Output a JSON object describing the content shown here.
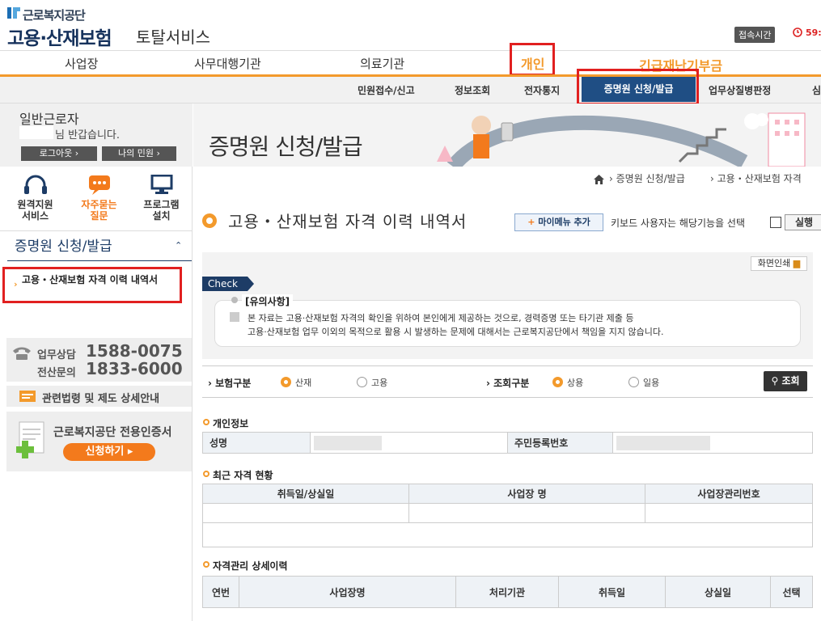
{
  "header": {
    "org_name": "근로복지공단",
    "service_name": "고용·산재보험",
    "service_suffix": "토탈서비스",
    "session_label": "접속시간",
    "session_timer": "59:"
  },
  "gnb": {
    "items": [
      "사업장",
      "사무대행기관",
      "의료기관",
      "개인",
      "긴급재난기부금"
    ]
  },
  "snb": {
    "items": [
      "민원접수/신고",
      "정보조회",
      "전자통지",
      "증명원 신청/발급",
      "업무상질병판정",
      "심"
    ]
  },
  "user": {
    "type": "일반근로자",
    "greeting": "님 반갑습니다.",
    "logout": "로그아웃",
    "my_civil": "나의 민원"
  },
  "quick": [
    {
      "label": "원격지원\n서비스",
      "icon": "headset-icon"
    },
    {
      "label": "자주묻는\n질문",
      "icon": "chat-icon"
    },
    {
      "label": "프로그램\n설치",
      "icon": "monitor-icon"
    }
  ],
  "lnb": {
    "title": "증명원 신청/발급",
    "item": "고용・산재보험 자격 이력 내역서"
  },
  "contact": {
    "work_label": "업무상담",
    "work_number": "1588-0075",
    "it_label": "전산문의",
    "it_number": "1833-6000",
    "law_link": "관련법령 및 제도 상세안내",
    "cert_title": "근로복지공단 전용인증서",
    "cert_btn": "신청하기"
  },
  "banner": {
    "title": "증명원 신청/발급"
  },
  "breadcrumb": {
    "items": [
      "증명원 신청/발급",
      "고용・산재보험 자격"
    ]
  },
  "page": {
    "title": "고용・산재보험 자격 이력 내역서",
    "mymenu": "마이메뉴 추가",
    "keyboard_note": "키보드 사용자는 해당기능을 선택",
    "exec": "실행",
    "print": "화면인쇄"
  },
  "notice": {
    "tag": "Check",
    "title": "[유의사항]",
    "line1": "본 자료는 고용·산재보험 자격의 확인을 위하여 본인에게 제공하는 것으로, 경력증명 또는 타기관 제출 등",
    "line2": "고용·산재보험 업무 이외의 목적으로 활용 시 발생하는 문제에 대해서는 근로복지공단에서 책임을 지지 않습니다."
  },
  "filter": {
    "insurance_label": "보험구분",
    "insurance_options": [
      "산재",
      "고용"
    ],
    "insurance_selected": "산재",
    "query_label": "조회구분",
    "query_options": [
      "상용",
      "일용"
    ],
    "query_selected": "상용",
    "search": "조회"
  },
  "personal": {
    "title": "개인정보",
    "name_label": "성명",
    "rrn_label": "주민등록번호"
  },
  "recent": {
    "title": "최근 자격 현황",
    "headers": [
      "취득일/상실일",
      "사업장 명",
      "사업장관리번호"
    ]
  },
  "history": {
    "title": "자격관리 상세이력",
    "headers": [
      "연번",
      "사업장명",
      "처리기관",
      "취득일",
      "상실일",
      "선택"
    ]
  },
  "colors": {
    "accent": "#f39a2c",
    "navy": "#1f4e84",
    "highlight": "#e12020"
  }
}
